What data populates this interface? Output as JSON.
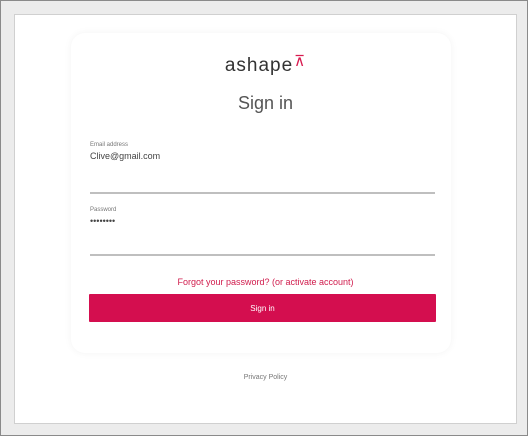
{
  "brand": {
    "name": "ashape",
    "mark_glyph": "⊼",
    "accent_color": "#d40e4f"
  },
  "title": "Sign in",
  "email": {
    "label": "Email address",
    "value": "Clive@gmail.com"
  },
  "password": {
    "label": "Password",
    "value": "••••••••"
  },
  "forgot_link": "Forgot your password? (or activate account)",
  "signin_button": "Sign in",
  "privacy_link": "Privacy Policy"
}
